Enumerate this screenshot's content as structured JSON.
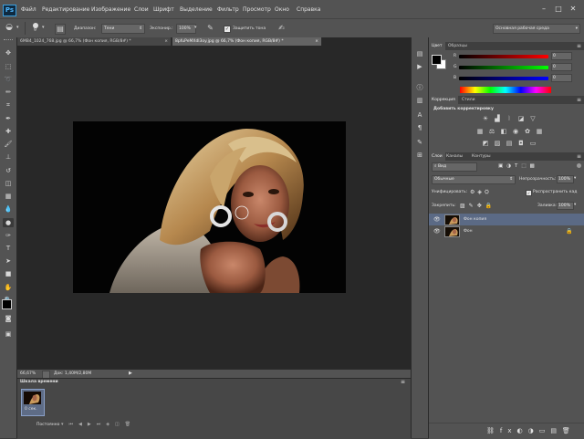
{
  "app": {
    "logo": "Ps"
  },
  "menu": [
    "Файл",
    "Редактирование",
    "Изображение",
    "Слои",
    "Шрифт",
    "Выделение",
    "Фильтр",
    "Просмотр",
    "Окно",
    "Справка"
  ],
  "window_buttons": {
    "minimize": "–",
    "restore": "□",
    "close": "✕"
  },
  "options": {
    "brush_size": "9",
    "range_label": "Диапазон:",
    "range_value": "Тени",
    "exposure_label": "Экспонир.:",
    "exposure_value": "100%",
    "protect_label": "Защитить тона",
    "workspace": "Основная рабочая среда"
  },
  "tabs": [
    {
      "label": "6MB4_1024_768.jpg @ 66,7% (Фон копия, RGB/8#) *",
      "close": "×",
      "active": false
    },
    {
      "label": "8pfuPeMXdl3oy.jpg @ 66,7% (Фон копия, RGB/8#) *",
      "close": "×",
      "active": true
    }
  ],
  "status": {
    "zoom": "66,67%",
    "doc": "Док: 1,40M/2,80M"
  },
  "timeline": {
    "title": "Шкала времени",
    "frame_time": "0 сек.",
    "loop": "Постоянно"
  },
  "color_panel": {
    "tabs": [
      "Цвет",
      "Образцы"
    ],
    "channels": [
      {
        "label": "R",
        "value": "0"
      },
      {
        "label": "G",
        "value": "0"
      },
      {
        "label": "B",
        "value": "0"
      }
    ],
    "foreground": "#000000",
    "background": "#ffffff"
  },
  "adjustments_panel": {
    "tabs": [
      "Коррекция",
      "Стили"
    ],
    "subtitle": "Добавить корректировку"
  },
  "layers_panel": {
    "tabs": [
      "Слои",
      "Каналы",
      "Контуры"
    ],
    "filter": "Вид",
    "blend_mode": "Обычные",
    "opacity_label": "Непрозрачность:",
    "opacity_value": "100%",
    "unify_label": "Унифицировать:",
    "propagate_label": "Распространить кад",
    "lock_label": "Закрепить:",
    "fill_label": "Заливка:",
    "fill_value": "100%",
    "layers": [
      {
        "name": "Фон копия",
        "selected": true
      },
      {
        "name": "Фон",
        "selected": false
      }
    ]
  },
  "colors": {
    "menubar": "#535353",
    "document_bg": "#282828",
    "selected_layer": "#5b6a85",
    "logo_blue": "#4fb8ff"
  }
}
